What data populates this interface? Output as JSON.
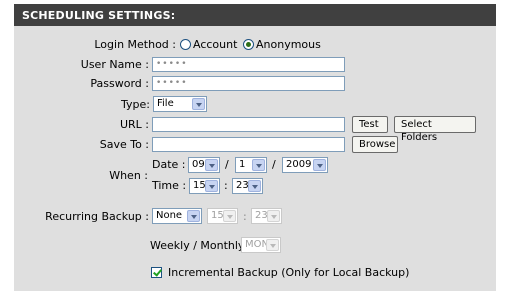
{
  "header": {
    "title": "SCHEDULING SETTINGS:"
  },
  "login_method": {
    "label": "Login Method :",
    "options": [
      "Account",
      "Anonymous"
    ],
    "selected": "Anonymous"
  },
  "user_name": {
    "label": "User Name :",
    "value": "•••••"
  },
  "password": {
    "label": "Password :",
    "value": "•••••"
  },
  "type": {
    "label": "Type:",
    "value": "File"
  },
  "url": {
    "label": "URL :",
    "value": "",
    "test_label": "Test",
    "select_folders_label": "Select Folders"
  },
  "save_to": {
    "label": "Save To :",
    "value": "",
    "browse_label": "Browse"
  },
  "when": {
    "label": "When :",
    "date_label": "Date :",
    "month": "09",
    "day": "1",
    "year": "2009",
    "sep1": "/",
    "sep2": "/",
    "time_label": "Time :",
    "hour": "15",
    "minute": "23",
    "time_sep": ":"
  },
  "recurring": {
    "label": "Recurring Backup :",
    "value": "None",
    "hour": "15",
    "minute": "23",
    "time_sep": ":",
    "weekly_label": "Weekly / Monthly :",
    "weekly_value": "MON"
  },
  "incremental": {
    "checked": true,
    "label": "Incremental Backup (Only for Local Backup)"
  }
}
